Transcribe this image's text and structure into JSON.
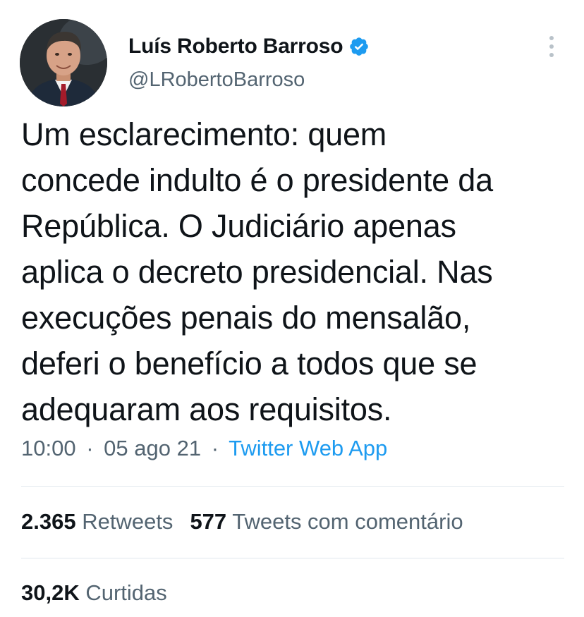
{
  "author": {
    "display_name": "Luís Roberto Barroso",
    "handle": "@LRobertoBarroso",
    "verified": true,
    "avatar_icon": "profile-photo"
  },
  "tweet": {
    "lines": [
      "Um esclarecimento: quem",
      "concede indulto é o presidente da",
      "República. O Judiciário apenas",
      "aplica o decreto presidencial. Nas",
      "execuções penais do mensalão,",
      "deferi o benefício a todos que se",
      "adequaram aos requisitos."
    ],
    "time": "10:00",
    "date": "05 ago 21",
    "separator": "·",
    "source": "Twitter Web App"
  },
  "stats": {
    "retweets_count": "2.365",
    "retweets_label": "Retweets",
    "quotes_count": "577",
    "quotes_label": "Tweets com comentário",
    "likes_count": "30,2K",
    "likes_label": "Curtidas"
  },
  "colors": {
    "text": "#0f1419",
    "secondary": "#536471",
    "link": "#1d9bf0",
    "verified": "#1d9bf0",
    "divider": "#e1e8ed"
  },
  "icons": {
    "verified": "verified-badge-icon",
    "more": "more-options-icon"
  }
}
